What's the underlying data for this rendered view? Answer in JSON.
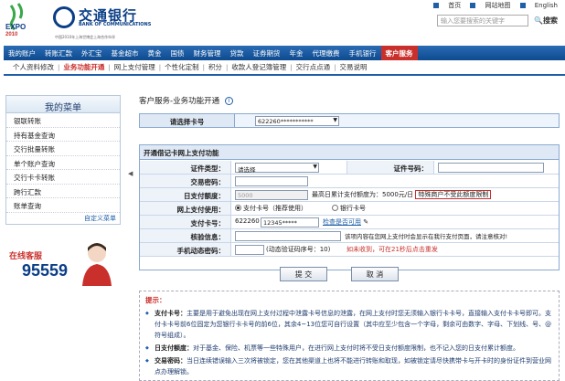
{
  "header": {
    "expo_text": "EXPO 2010 SHANGHAI CHINA",
    "bank_name_cn": "交通银行",
    "bank_name_en": "BANK OF COMMUNICATIONS",
    "expo_sub": "中国2010年上海世博会上海合作伙伴",
    "links": [
      "首页",
      "网站地图",
      "English"
    ],
    "search_placeholder": "输入您要搜索的关键字",
    "search_button": "搜索"
  },
  "nav": {
    "items": [
      "我的账户",
      "转账汇款",
      "外汇宝",
      "基金超市",
      "黄金",
      "国债",
      "财务管理",
      "贷款",
      "证券期货",
      "年金",
      "代理缴费",
      "手机银行",
      "客户服务"
    ],
    "active_index": 12
  },
  "subnav": {
    "items": [
      "个人资料修改",
      "业务功能开通",
      "网上支付管理",
      "个性化定制",
      "积分",
      "收款人登记簿管理",
      "交行点点通",
      "交易说明"
    ],
    "active_index": 1
  },
  "sidebar": {
    "title": "我的菜单",
    "items": [
      "银联转账",
      "持有基金查询",
      "交行批量转账",
      "单个账户查询",
      "交行卡卡转账",
      "跨行汇款",
      "账单查询"
    ],
    "custom_link": "自定义菜单",
    "cs_label": "在线客服",
    "cs_number": "95559"
  },
  "content": {
    "title": "客户服务-业务功能开通",
    "select_card_label": "请选择卡号",
    "select_card_value": "622260***********",
    "form_title": "开通借记卡网上支付功能",
    "id_type_label": "证件类型：",
    "id_type_value": "请选择",
    "id_no_label": "证件号码：",
    "trade_pwd_label": "交易密码：",
    "daily_limit_label": "日支付额度：",
    "daily_limit_value": "5000",
    "daily_limit_note": "最高日累计支付额度为：5000元/日",
    "daily_limit_special": "特殊商户不受此额度限制",
    "net_pay_label": "网上支付使用：",
    "radio1": "支付卡号（推荐使用）",
    "radio2": "银行卡号",
    "pay_card_label": "支付卡号：",
    "pay_card_prefix": "622260",
    "pay_card_value": "12345*****",
    "check_link": "检查是否可用",
    "verify_label": "核验信息：",
    "verify_note": "该项内容在您网上支付时会显示在我行支付页面，请注意核对!",
    "sms_label": "手机动态密码：",
    "sms_hint": "(动态验证码序号：10)",
    "sms_not_received": "如未收到，可在21秒后点击重发",
    "submit_btn": "提  交",
    "cancel_btn": "取  消"
  },
  "tips": {
    "title": "提示：",
    "items": [
      {
        "key": "支付卡号：",
        "text": "主要是用于避免出现在网上支付过程中泄露卡号信息的泄露，在网上支付时您无须输入银行卡卡号，直接输入支付卡卡号即可。支付卡卡号前6位固定为您银行卡卡号的前6位，其余4~13位您可自行设置（其中应至少包含一个字母，剩余可由数字、字母、下划线、号、@符号组成）。"
      },
      {
        "key": "日支付额度：",
        "text": "对于基金、保险、机票等一些特殊用户，在进行网上支付时将不受日支付额度限制，也不记入您的日支付累计额度。"
      },
      {
        "key": "交易密码：",
        "text": "当日连续错误输入三次将被锁定，您在其他渠道上也将不能进行转账和取现，如被锁定请尽快携带卡与开卡时的身份证件到营业网点办理解锁。"
      }
    ]
  }
}
